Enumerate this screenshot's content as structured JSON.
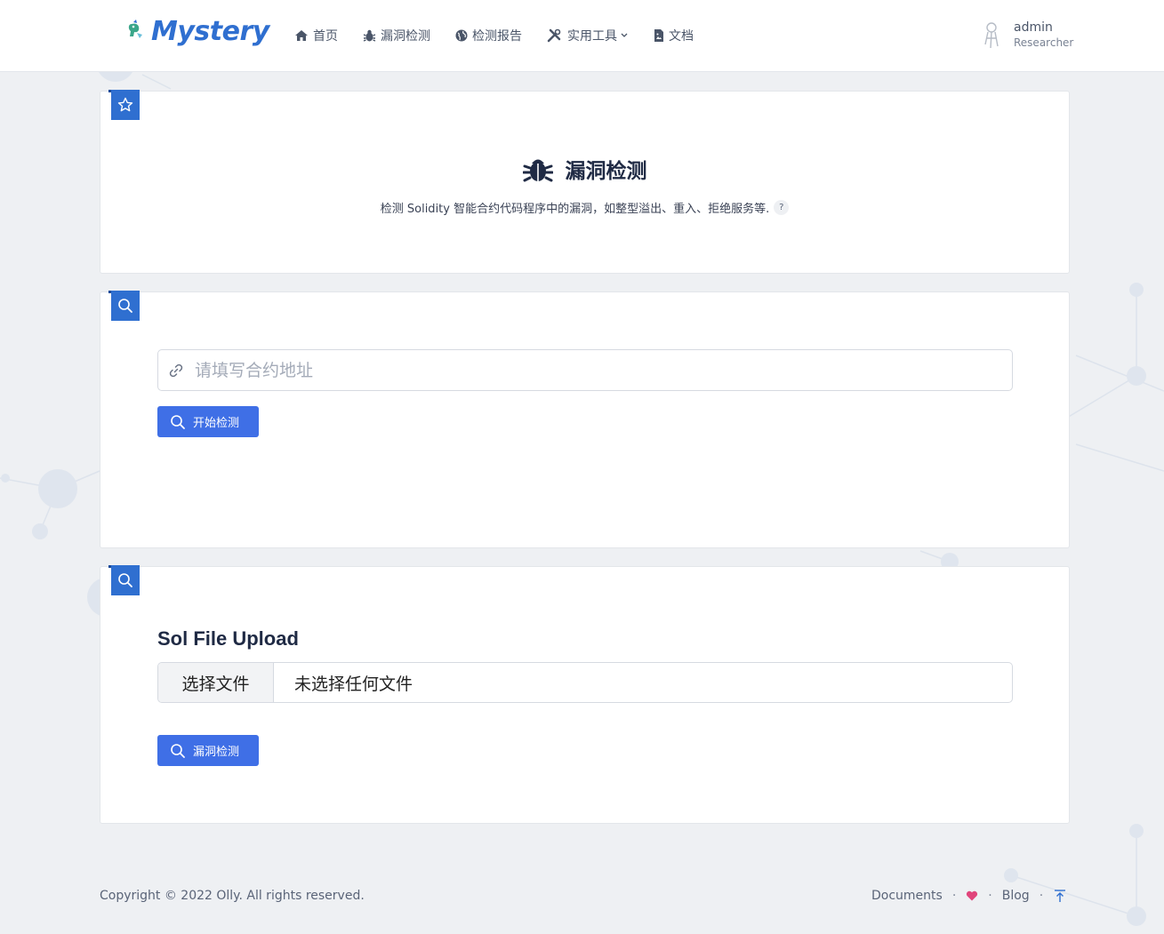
{
  "brand": {
    "name": "Mystery",
    "accent": "#2f6fd0"
  },
  "nav": {
    "items": [
      {
        "label": "首页",
        "icon": "home-icon"
      },
      {
        "label": "漏洞检测",
        "icon": "bug-icon"
      },
      {
        "label": "检测报告",
        "icon": "globe-icon"
      },
      {
        "label": "实用工具",
        "icon": "tools-icon"
      },
      {
        "label": "文档",
        "icon": "file-image-icon"
      }
    ]
  },
  "user": {
    "name": "admin",
    "role": "Researcher"
  },
  "intro": {
    "title": "漏洞检测",
    "description": "检测 Solidity 智能合约代码程序中的漏洞，如整型溢出、重入、拒绝服务等.",
    "help": "?"
  },
  "address_form": {
    "placeholder": "请填写合约地址",
    "value": "",
    "submit_label": "开始检测"
  },
  "upload_form": {
    "title": "Sol File Upload",
    "choose_label": "选择文件",
    "file_status": "未选择任何文件",
    "submit_label": "漏洞检测"
  },
  "footer": {
    "copyright": "Copyright © 2022 Olly. All rights reserved.",
    "documents": "Documents",
    "blog": "Blog",
    "separator": "·"
  },
  "colors": {
    "primary": "#2f6fd0",
    "button": "#3f6fe6",
    "heart": "#e0457b"
  }
}
